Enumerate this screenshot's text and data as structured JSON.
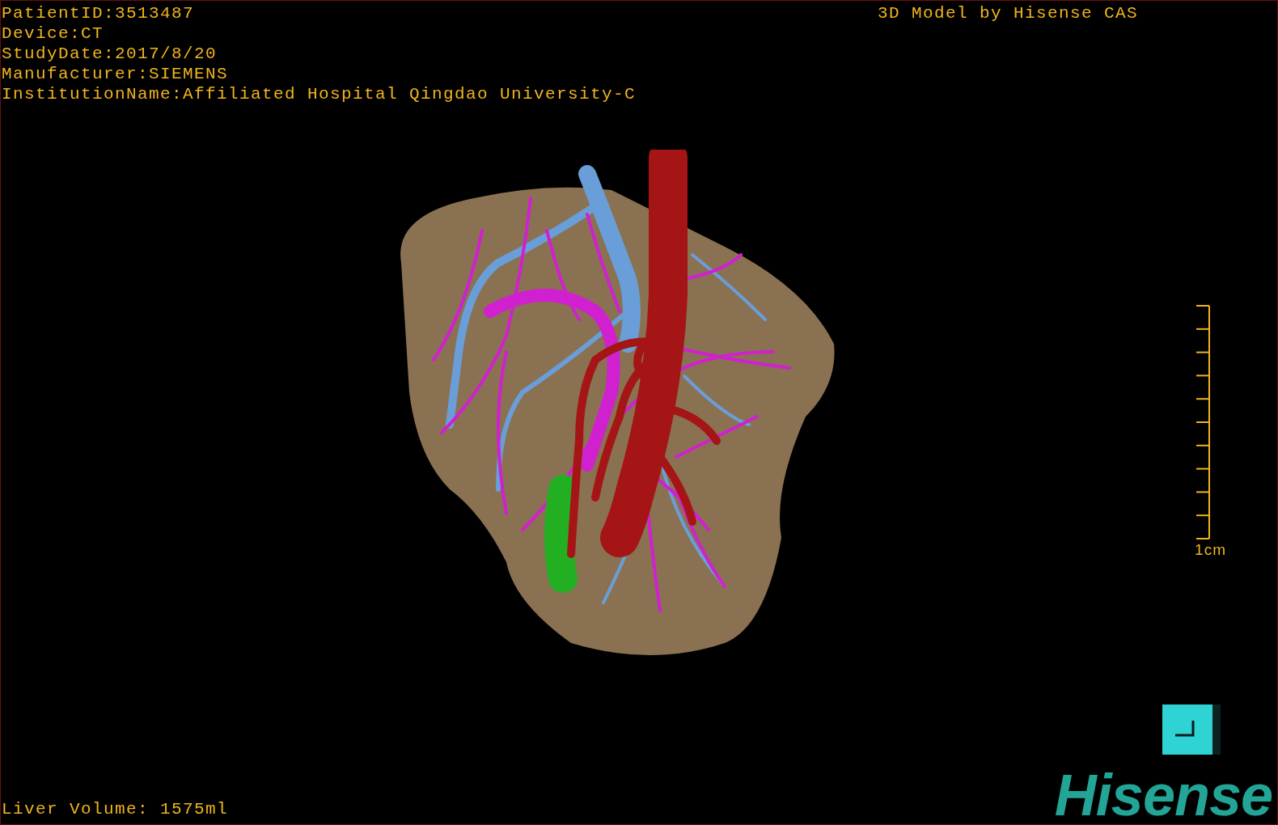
{
  "patient_info": [
    "PatientID:3513487",
    "Device:CT",
    "StudyDate:2017/8/20",
    "Manufacturer:SIEMENS",
    "InstitutionName:Affiliated Hospital Qingdao University-C"
  ],
  "title": "3D Model by Hisense CAS",
  "scale_bar": {
    "label": "1cm"
  },
  "liver_volume": "Liver Volume: 1575ml",
  "logo": "Hisense"
}
